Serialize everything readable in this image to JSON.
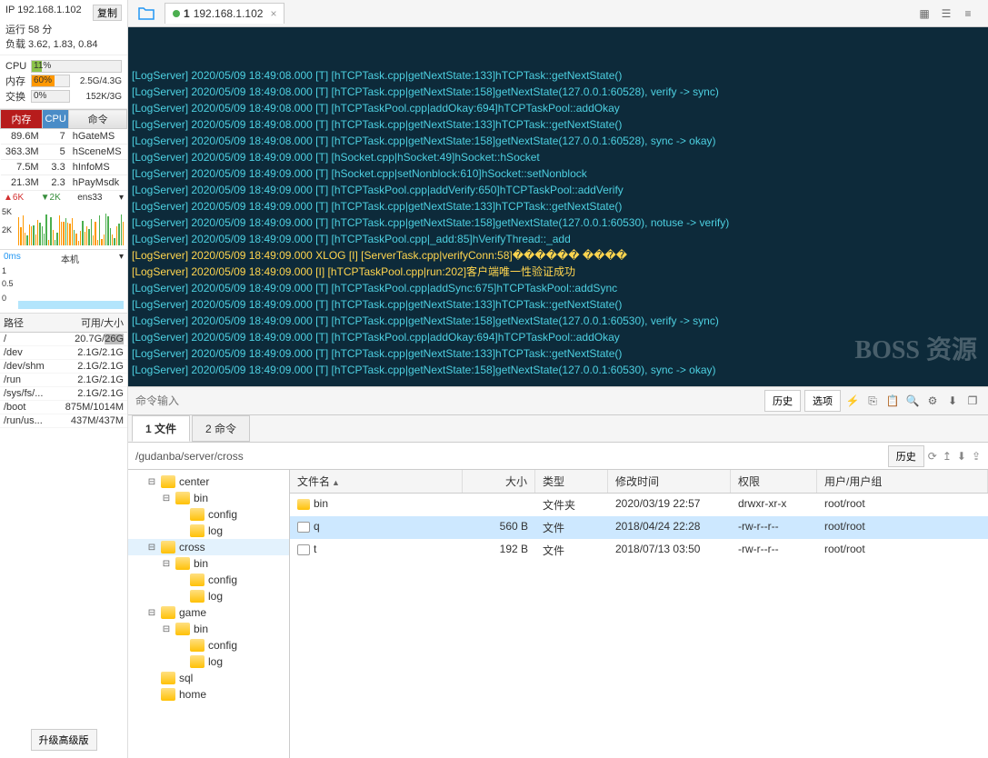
{
  "header": {
    "ip_label": "IP 192.168.1.102",
    "copy": "复制",
    "uptime": "运行 58 分",
    "load": "负载 3.62, 1.83, 0.84"
  },
  "meters": {
    "cpu_label": "CPU",
    "cpu_val": "11%",
    "mem_label": "内存",
    "mem_val": "60%",
    "mem_right": "2.5G/4.3G",
    "swap_label": "交换",
    "swap_val": "0%",
    "swap_right": "152K/3G"
  },
  "proc_head": {
    "mem": "内存",
    "cpu": "CPU",
    "cmd": "命令"
  },
  "procs": [
    {
      "mem": "89.6M",
      "cpu": "7",
      "cmd": "hGateMS"
    },
    {
      "mem": "363.3M",
      "cpu": "5",
      "cmd": "hSceneMS"
    },
    {
      "mem": "7.5M",
      "cpu": "3.3",
      "cmd": "hInfoMS"
    },
    {
      "mem": "21.3M",
      "cpu": "2.3",
      "cmd": "hPayMsdk"
    }
  ],
  "net": {
    "up": "6K",
    "down": "2K",
    "iface": "ens33",
    "y1": "5K",
    "y2": "2K"
  },
  "perf": {
    "latency": "0ms",
    "host": "本机",
    "y1": "1",
    "y2": "0.5",
    "y3": "0"
  },
  "fs_head": {
    "path": "路径",
    "size": "可用/大小"
  },
  "fs": [
    {
      "path": "/",
      "size": "20.7G/26G"
    },
    {
      "path": "/dev",
      "size": "2.1G/2.1G"
    },
    {
      "path": "/dev/shm",
      "size": "2.1G/2.1G"
    },
    {
      "path": "/run",
      "size": "2.1G/2.1G"
    },
    {
      "path": "/sys/fs/...",
      "size": "2.1G/2.1G"
    },
    {
      "path": "/boot",
      "size": "875M/1014M"
    },
    {
      "path": "/run/us...",
      "size": "437M/437M"
    }
  ],
  "upgrade": "升级高级版",
  "tab": {
    "num": "1",
    "label": "192.168.1.102"
  },
  "terminal": [
    {
      "c": "cyan",
      "t": "[LogServer] 2020/05/09 18:49:08.000 [T] [hTCPTask.cpp|getNextState:133]hTCPTask::getNextState()"
    },
    {
      "c": "cyan",
      "t": "[LogServer] 2020/05/09 18:49:08.000 [T] [hTCPTask.cpp|getNextState:158]getNextState(127.0.0.1:60528), verify -> sync)"
    },
    {
      "c": "cyan",
      "t": "[LogServer] 2020/05/09 18:49:08.000 [T] [hTCPTaskPool.cpp|addOkay:694]hTCPTaskPool::addOkay"
    },
    {
      "c": "cyan",
      "t": "[LogServer] 2020/05/09 18:49:08.000 [T] [hTCPTask.cpp|getNextState:133]hTCPTask::getNextState()"
    },
    {
      "c": "cyan",
      "t": "[LogServer] 2020/05/09 18:49:08.000 [T] [hTCPTask.cpp|getNextState:158]getNextState(127.0.0.1:60528), sync -> okay)"
    },
    {
      "c": "cyan",
      "t": "[LogServer] 2020/05/09 18:49:09.000 [T] [hSocket.cpp|hSocket:49]hSocket::hSocket"
    },
    {
      "c": "cyan",
      "t": "[LogServer] 2020/05/09 18:49:09.000 [T] [hSocket.cpp|setNonblock:610]hSocket::setNonblock"
    },
    {
      "c": "cyan",
      "t": "[LogServer] 2020/05/09 18:49:09.000 [T] [hTCPTaskPool.cpp|addVerify:650]hTCPTaskPool::addVerify"
    },
    {
      "c": "cyan",
      "t": "[LogServer] 2020/05/09 18:49:09.000 [T] [hTCPTask.cpp|getNextState:133]hTCPTask::getNextState()"
    },
    {
      "c": "cyan",
      "t": "[LogServer] 2020/05/09 18:49:09.000 [T] [hTCPTask.cpp|getNextState:158]getNextState(127.0.0.1:60530), notuse -> verify)"
    },
    {
      "c": "cyan",
      "t": "[LogServer] 2020/05/09 18:49:09.000 [T] [hTCPTaskPool.cpp|_add:85]hVerifyThread::_add"
    },
    {
      "c": "yellow",
      "t": "[LogServer] 2020/05/09 18:49:09.000 XLOG [I] [ServerTask.cpp|verifyConn:58]������ ����"
    },
    {
      "c": "yellow",
      "t": "[LogServer] 2020/05/09 18:49:09.000 [I] [hTCPTaskPool.cpp|run:202]客户端唯一性验证成功"
    },
    {
      "c": "cyan",
      "t": "[LogServer] 2020/05/09 18:49:09.000 [T] [hTCPTaskPool.cpp|addSync:675]hTCPTaskPool::addSync"
    },
    {
      "c": "cyan",
      "t": "[LogServer] 2020/05/09 18:49:09.000 [T] [hTCPTask.cpp|getNextState:133]hTCPTask::getNextState()"
    },
    {
      "c": "cyan",
      "t": "[LogServer] 2020/05/09 18:49:09.000 [T] [hTCPTask.cpp|getNextState:158]getNextState(127.0.0.1:60530), verify -> sync)"
    },
    {
      "c": "cyan",
      "t": "[LogServer] 2020/05/09 18:49:09.000 [T] [hTCPTaskPool.cpp|addOkay:694]hTCPTaskPool::addOkay"
    },
    {
      "c": "cyan",
      "t": "[LogServer] 2020/05/09 18:49:09.000 [T] [hTCPTask.cpp|getNextState:133]hTCPTask::getNextState()"
    },
    {
      "c": "cyan",
      "t": "[LogServer] 2020/05/09 18:49:09.000 [T] [hTCPTask.cpp|getNextState:158]getNextState(127.0.0.1:60530), sync -> okay)"
    }
  ],
  "watermark": "BOSS 资源",
  "cmdbar": {
    "placeholder": "命令输入",
    "history": "历史",
    "options": "选项"
  },
  "btabs": {
    "t1": "1 文件",
    "t2": "2 命令"
  },
  "pathbar": {
    "path": "/gudanba/server/cross",
    "history": "历史"
  },
  "tree": [
    {
      "d": 1,
      "toggle": "⊟",
      "label": "center"
    },
    {
      "d": 2,
      "toggle": "⊟",
      "label": "bin"
    },
    {
      "d": 3,
      "toggle": "",
      "label": "config"
    },
    {
      "d": 3,
      "toggle": "",
      "label": "log"
    },
    {
      "d": 1,
      "toggle": "⊟",
      "label": "cross",
      "sel": true
    },
    {
      "d": 2,
      "toggle": "⊟",
      "label": "bin"
    },
    {
      "d": 3,
      "toggle": "",
      "label": "config"
    },
    {
      "d": 3,
      "toggle": "",
      "label": "log"
    },
    {
      "d": 1,
      "toggle": "⊟",
      "label": "game"
    },
    {
      "d": 2,
      "toggle": "⊟",
      "label": "bin"
    },
    {
      "d": 3,
      "toggle": "",
      "label": "config"
    },
    {
      "d": 3,
      "toggle": "",
      "label": "log"
    },
    {
      "d": 1,
      "toggle": "",
      "label": "sql"
    },
    {
      "d": 1,
      "toggle": "",
      "label": "home"
    }
  ],
  "list_head": {
    "name": "文件名",
    "size": "大小",
    "type": "类型",
    "date": "修改时间",
    "perm": "权限",
    "user": "用户/用户组"
  },
  "files": [
    {
      "icon": "folder",
      "name": "bin",
      "size": "",
      "type": "文件夹",
      "date": "2020/03/19 22:57",
      "perm": "drwxr-xr-x",
      "user": "root/root"
    },
    {
      "icon": "doc",
      "name": "q",
      "size": "560 B",
      "type": "文件",
      "date": "2018/04/24 22:28",
      "perm": "-rw-r--r--",
      "user": "root/root",
      "sel": true
    },
    {
      "icon": "doc",
      "name": "t",
      "size": "192 B",
      "type": "文件",
      "date": "2018/07/13 03:50",
      "perm": "-rw-r--r--",
      "user": "root/root"
    }
  ]
}
